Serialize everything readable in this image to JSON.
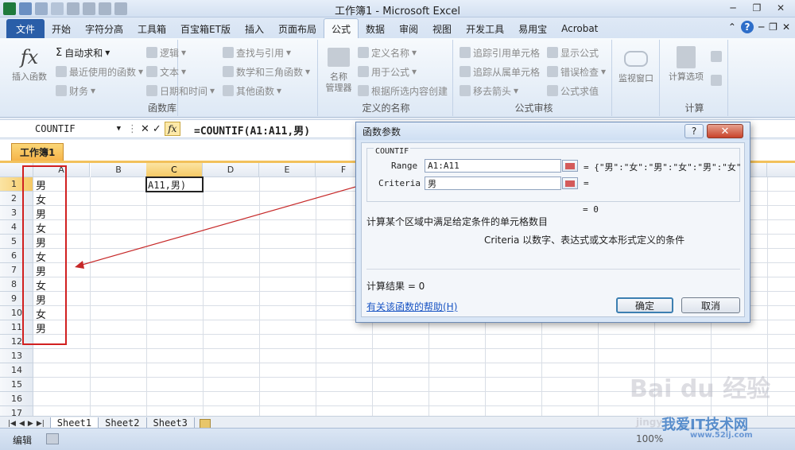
{
  "window": {
    "title": "工作簿1 - Microsoft Excel"
  },
  "tabs": [
    "文件",
    "开始",
    "字符分高",
    "工具箱",
    "百宝箱ET版",
    "插入",
    "页面布局",
    "公式",
    "数据",
    "审阅",
    "视图",
    "开发工具",
    "易用宝",
    "Acrobat"
  ],
  "active_tab_index": 7,
  "ribbon": {
    "insert_function": "插入函数",
    "autosum": "自动求和",
    "recent": "最近使用的函数",
    "finance": "财务",
    "logic": "逻辑",
    "text": "文本",
    "datetime": "日期和时间",
    "lookup": "查找与引用",
    "math": "数学和三角函数",
    "other": "其他函数",
    "group_library": "函数库",
    "name_manager_1": "名称",
    "name_manager_2": "管理器",
    "define_name": "定义名称",
    "use_in_formula": "用于公式",
    "create_from_sel": "根据所选内容创建",
    "group_names": "定义的名称",
    "trace_precedents": "追踪引用单元格",
    "trace_dependents": "追踪从属单元格",
    "remove_arrows": "移去箭头",
    "show_formulas": "显示公式",
    "error_check": "错误检查",
    "eval_formula": "公式求值",
    "group_audit": "公式审核",
    "watch_window": "监视窗口",
    "calc_options": "计算选项",
    "group_calc": "计算"
  },
  "formula_bar": {
    "name_box": "COUNTIF",
    "formula": "=COUNTIF(A1:A11,男)"
  },
  "workbook": {
    "tab": "工作簿1"
  },
  "columns": [
    "A",
    "B",
    "C",
    "D",
    "E",
    "F"
  ],
  "rows": [
    "1",
    "2",
    "3",
    "4",
    "5",
    "6",
    "7",
    "8",
    "9",
    "10",
    "11",
    "12",
    "13",
    "14",
    "15",
    "16",
    "17"
  ],
  "col_a_values": [
    "男",
    "女",
    "男",
    "女",
    "男",
    "女",
    "男",
    "女",
    "男",
    "女",
    "男"
  ],
  "active_cell_text": "A11,男)",
  "sheets": [
    "Sheet1",
    "Sheet2",
    "Sheet3"
  ],
  "status": {
    "mode": "编辑",
    "zoom": "100%"
  },
  "dialog": {
    "title": "函数参数",
    "function": "COUNTIF",
    "range_label": "Range",
    "range_value": "A1:A11",
    "range_result": "= {\"男\":\"女\":\"男\":\"女\":\"男\":\"女\"",
    "criteria_label": "Criteria",
    "criteria_value": "男",
    "criteria_result": "=",
    "total_result": "= 0",
    "description": "计算某个区域中满足给定条件的单元格数目",
    "arg_help": "Criteria  以数字、表达式或文本形式定义的条件",
    "calc_result": "计算结果 = 0",
    "help_link": "有关该函数的帮助(H)",
    "ok": "确定",
    "cancel": "取消"
  },
  "watermark": {
    "brand": "Bai du 经验",
    "site_cn": "我爱IT技术网",
    "site": "www.52ij.com",
    "url_prefix": "jingy"
  }
}
